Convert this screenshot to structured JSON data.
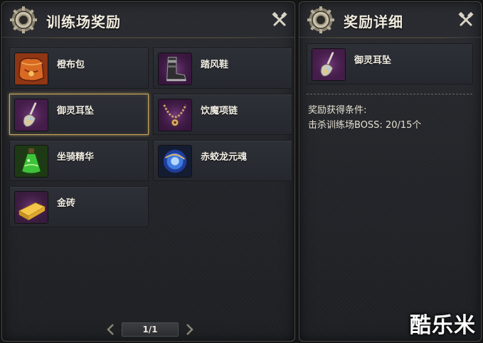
{
  "left_panel": {
    "title": "训练场奖励",
    "items": [
      {
        "label": "橙布包",
        "icon": "orange-cloth-bag-icon"
      },
      {
        "label": "踏风鞋",
        "icon": "wind-boots-icon"
      },
      {
        "label": "御灵耳坠",
        "icon": "spirit-earring-icon",
        "selected": true
      },
      {
        "label": "饮魔项链",
        "icon": "demon-necklace-icon"
      },
      {
        "label": "坐骑精华",
        "icon": "mount-essence-potion-icon"
      },
      {
        "label": "赤蛟龙元魂",
        "icon": "dragon-soul-orb-icon"
      },
      {
        "label": "金砖",
        "icon": "gold-brick-icon"
      }
    ],
    "pager": {
      "text": "1/1"
    }
  },
  "right_panel": {
    "title": "奖励详细",
    "selected_item": {
      "label": "御灵耳坠",
      "icon": "spirit-earring-icon"
    },
    "condition_title": "奖励获得条件:",
    "condition_value": "击杀训练场BOSS:  20/15个"
  },
  "watermark": "酷乐米",
  "colors": {
    "panel_bg": "#25272c",
    "selected_border": "#c9a55a",
    "text": "#f1ecdf"
  }
}
